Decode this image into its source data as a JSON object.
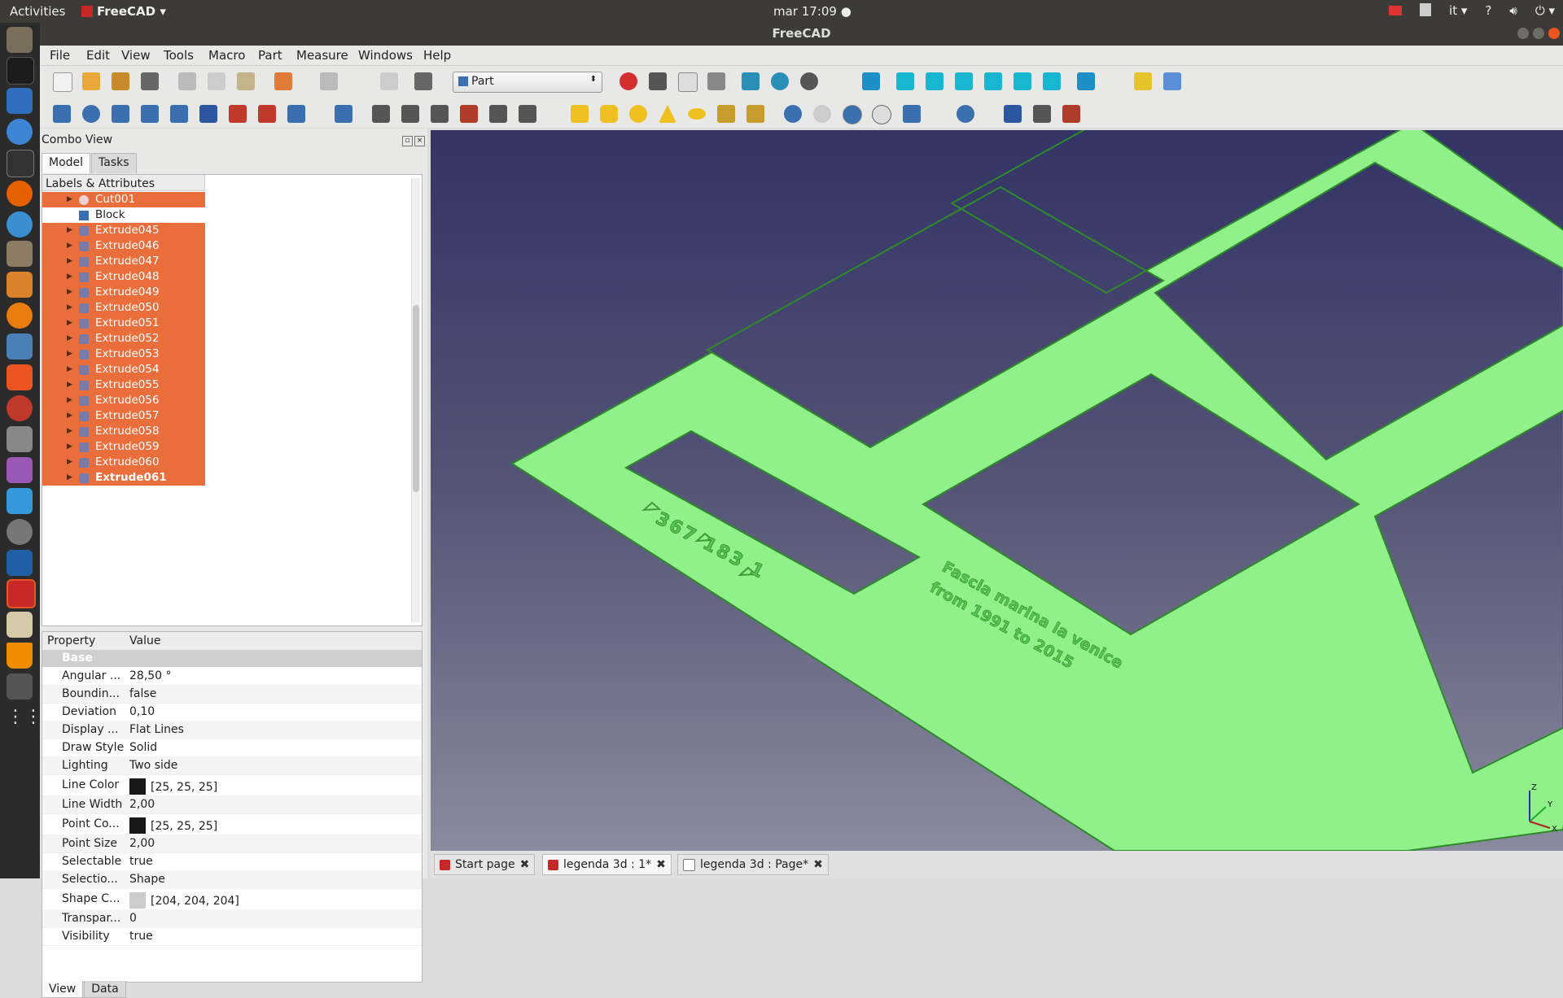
{
  "topbar": {
    "activities": "Activities",
    "app_name": "FreeCAD",
    "clock": "mar 17:09 ●",
    "language": "it ▾",
    "help": "?"
  },
  "window": {
    "title": "FreeCAD"
  },
  "menu": [
    "File",
    "Edit",
    "View",
    "Tools",
    "Macro",
    "Part",
    "Measure",
    "Windows",
    "Help"
  ],
  "workbench_selector": {
    "value": "Part"
  },
  "combo_view": {
    "title": "Combo View",
    "tabs": [
      "Model",
      "Tasks"
    ],
    "tree_header": "Labels & Attributes",
    "tree_items": [
      {
        "label": "Cut001",
        "selected": true,
        "expandable": true,
        "icon": "cut-icon"
      },
      {
        "label": "Block",
        "selected": false,
        "expandable": false,
        "icon": "block-icon"
      },
      {
        "label": "Extrude045",
        "selected": true,
        "expandable": true,
        "icon": "extrude-icon"
      },
      {
        "label": "Extrude046",
        "selected": true,
        "expandable": true,
        "icon": "extrude-icon"
      },
      {
        "label": "Extrude047",
        "selected": true,
        "expandable": true,
        "icon": "extrude-icon"
      },
      {
        "label": "Extrude048",
        "selected": true,
        "expandable": true,
        "icon": "extrude-icon"
      },
      {
        "label": "Extrude049",
        "selected": true,
        "expandable": true,
        "icon": "extrude-icon"
      },
      {
        "label": "Extrude050",
        "selected": true,
        "expandable": true,
        "icon": "extrude-icon"
      },
      {
        "label": "Extrude051",
        "selected": true,
        "expandable": true,
        "icon": "extrude-icon"
      },
      {
        "label": "Extrude052",
        "selected": true,
        "expandable": true,
        "icon": "extrude-icon"
      },
      {
        "label": "Extrude053",
        "selected": true,
        "expandable": true,
        "icon": "extrude-icon"
      },
      {
        "label": "Extrude054",
        "selected": true,
        "expandable": true,
        "icon": "extrude-icon"
      },
      {
        "label": "Extrude055",
        "selected": true,
        "expandable": true,
        "icon": "extrude-icon"
      },
      {
        "label": "Extrude056",
        "selected": true,
        "expandable": true,
        "icon": "extrude-icon"
      },
      {
        "label": "Extrude057",
        "selected": true,
        "expandable": true,
        "icon": "extrude-icon"
      },
      {
        "label": "Extrude058",
        "selected": true,
        "expandable": true,
        "icon": "extrude-icon"
      },
      {
        "label": "Extrude059",
        "selected": true,
        "expandable": true,
        "icon": "extrude-icon"
      },
      {
        "label": "Extrude060",
        "selected": true,
        "expandable": true,
        "icon": "extrude-icon"
      },
      {
        "label": "Extrude061",
        "selected": true,
        "expandable": true,
        "icon": "extrude-icon",
        "bold": true
      }
    ],
    "property_header": {
      "property": "Property",
      "value": "Value"
    },
    "group": "Base",
    "properties": [
      {
        "name": "Angular ...",
        "value": "28,50 °"
      },
      {
        "name": "Boundin...",
        "value": "false"
      },
      {
        "name": "Deviation",
        "value": "0,10"
      },
      {
        "name": "Display ...",
        "value": "Flat Lines"
      },
      {
        "name": "Draw Style",
        "value": "Solid"
      },
      {
        "name": "Lighting",
        "value": "Two side"
      },
      {
        "name": "Line Color",
        "value": "[25, 25, 25]",
        "swatch": "#191919"
      },
      {
        "name": "Line Width",
        "value": "2,00"
      },
      {
        "name": "Point Co...",
        "value": "[25, 25, 25]",
        "swatch": "#191919"
      },
      {
        "name": "Point Size",
        "value": "2,00"
      },
      {
        "name": "Selectable",
        "value": "true"
      },
      {
        "name": "Selectio...",
        "value": "Shape"
      },
      {
        "name": "Shape C...",
        "value": "[204, 204, 204]",
        "swatch": "#cccccc"
      },
      {
        "name": "Transpar...",
        "value": "0"
      },
      {
        "name": "Visibility",
        "value": "true"
      }
    ],
    "bottom_tabs": [
      "View",
      "Data"
    ]
  },
  "viewport": {
    "model_color": "#90f08a",
    "engraved_numbers": "367 183 1",
    "engraved_text_line1": "Fascia marina la venice",
    "engraved_text_line2": "from 1991 to 2015",
    "axis_labels": [
      "Z",
      "Y",
      "X"
    ]
  },
  "document_tabs": [
    {
      "label": "Start page",
      "active": false,
      "icon": "freecad-icon"
    },
    {
      "label": "legenda 3d : 1*",
      "active": true,
      "icon": "freecad-icon"
    },
    {
      "label": "legenda 3d : Page*",
      "active": false,
      "icon": "page-icon"
    }
  ],
  "colors": {
    "selection": "#e96e3c",
    "model_edge": "#2f8a2a",
    "bg_top": "#333366",
    "bg_bottom": "#8a8a9e"
  }
}
